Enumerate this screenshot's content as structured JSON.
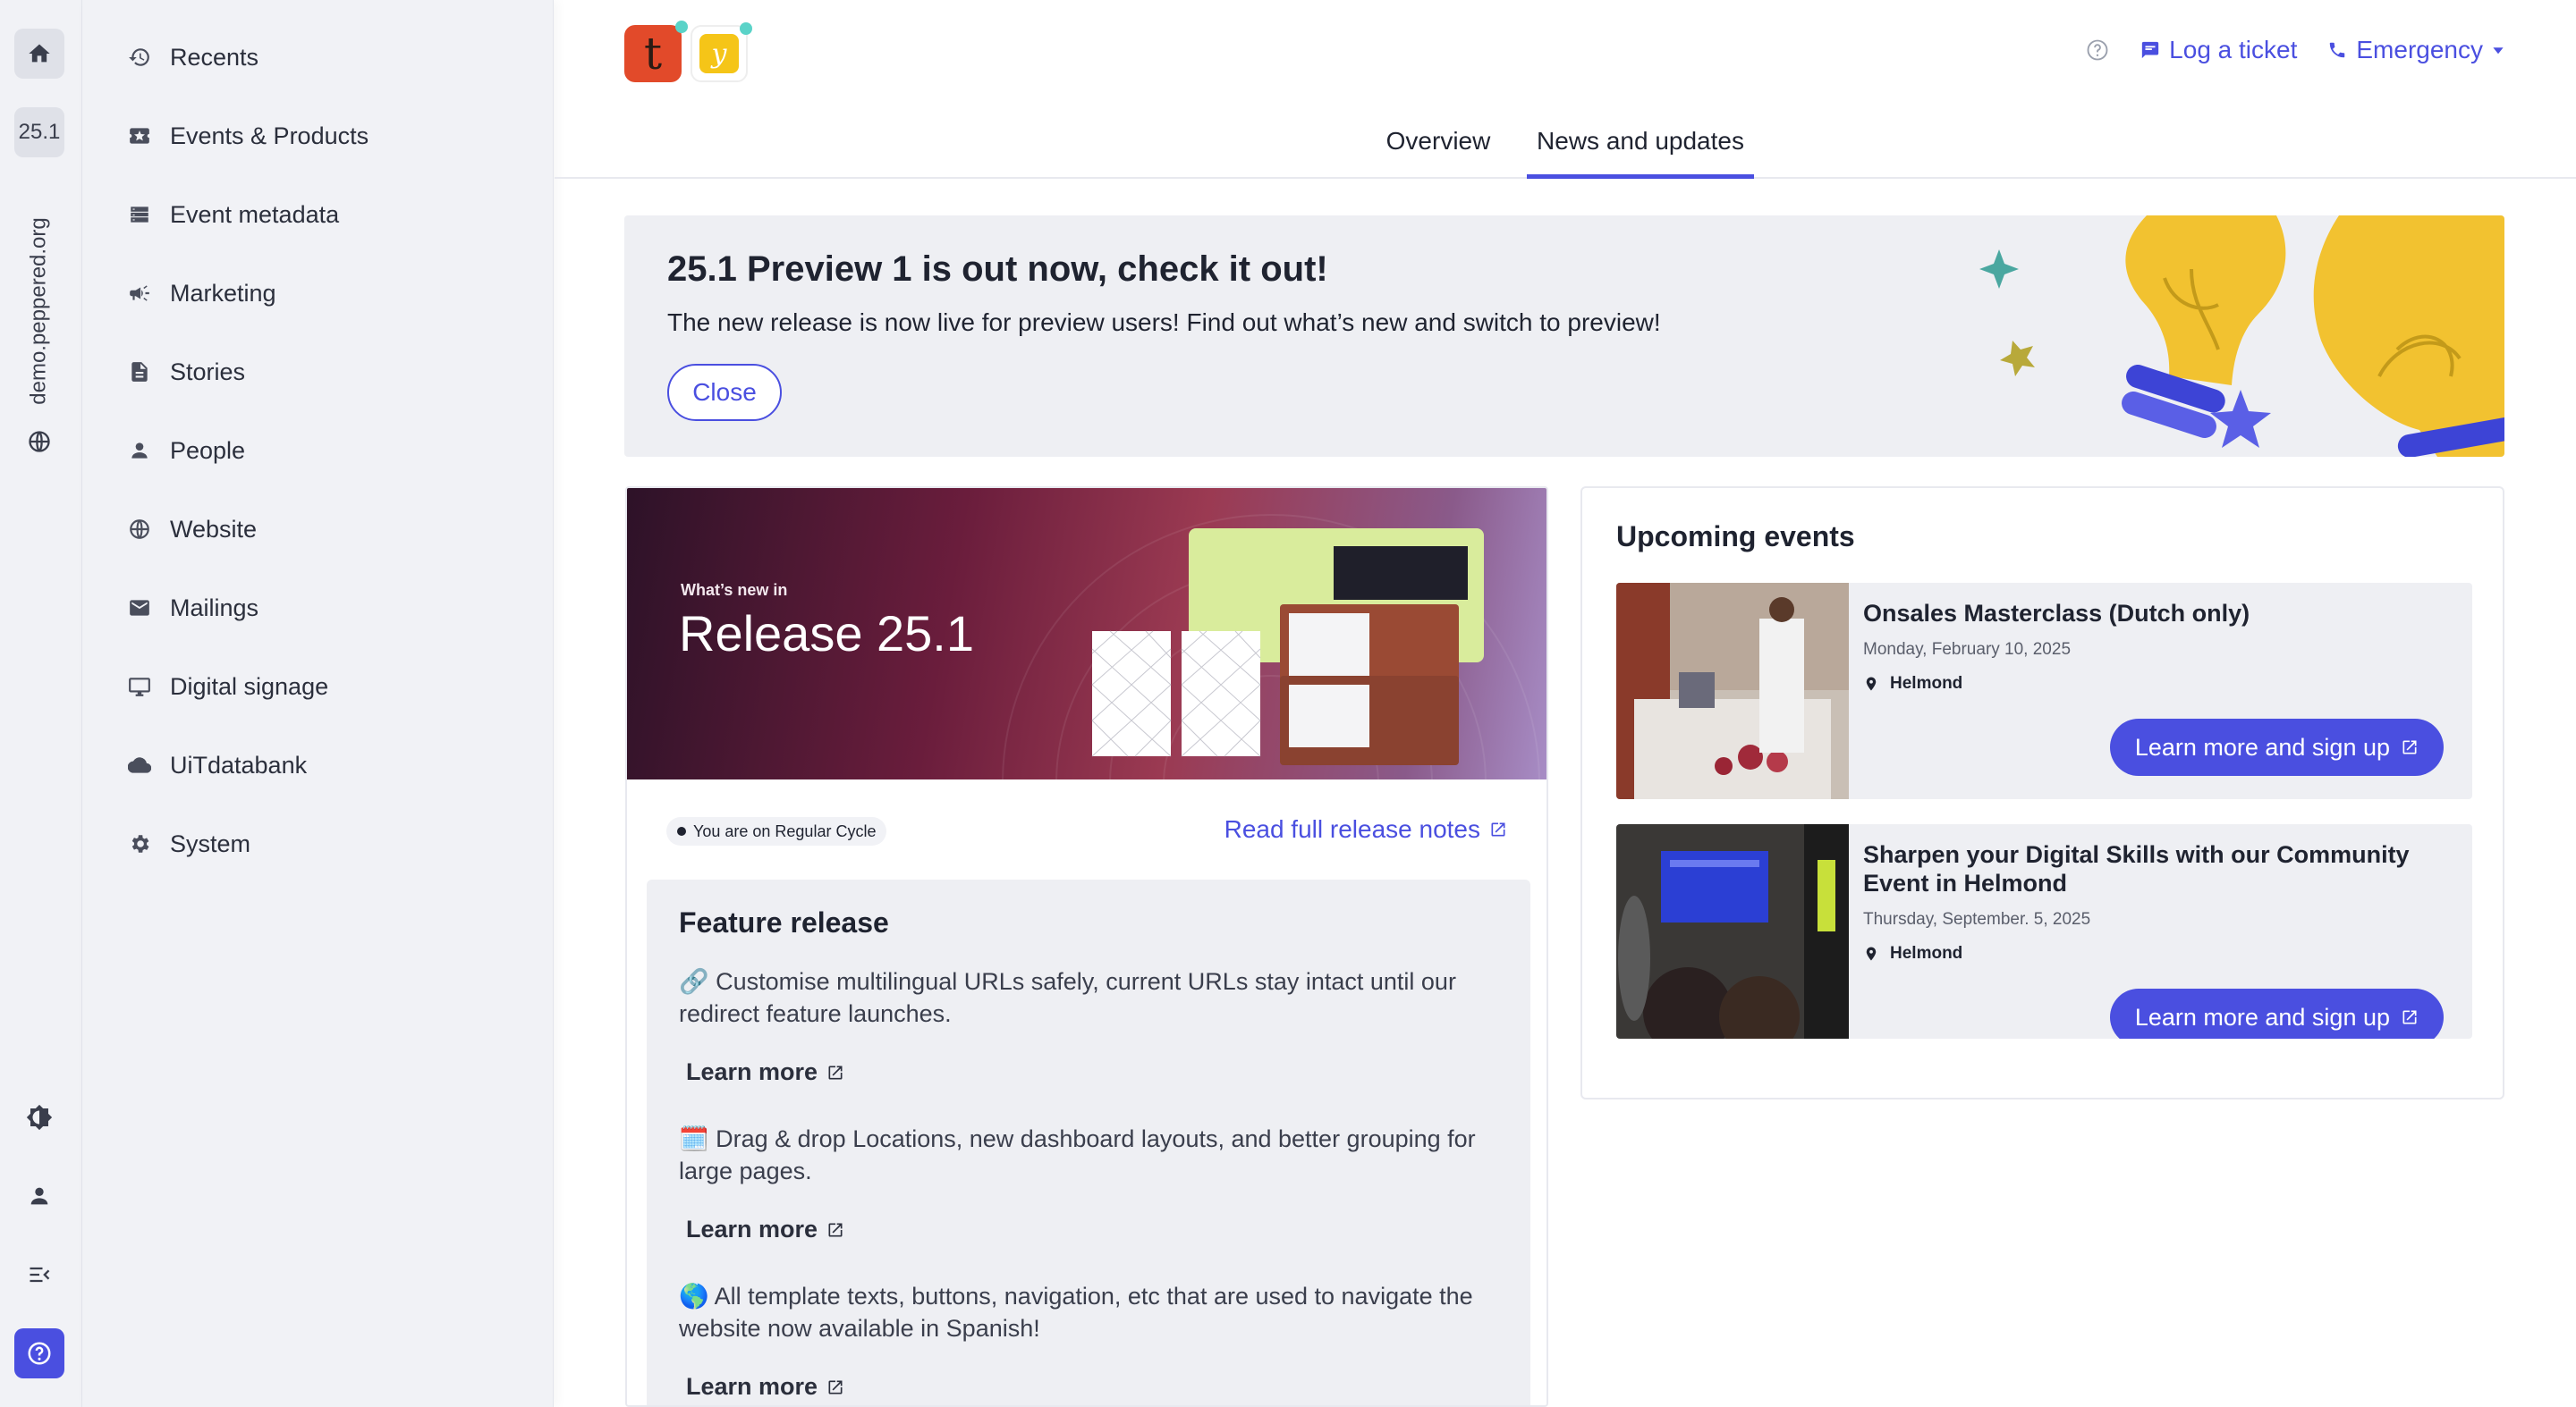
{
  "rail": {
    "version": "25.1",
    "site": "demo.peppered.org"
  },
  "nav": {
    "items": [
      {
        "label": "Recents",
        "icon": "history-icon"
      },
      {
        "label": "Events & Products",
        "icon": "ticket-icon"
      },
      {
        "label": "Event metadata",
        "icon": "list-icon"
      },
      {
        "label": "Marketing",
        "icon": "megaphone-icon"
      },
      {
        "label": "Stories",
        "icon": "document-icon"
      },
      {
        "label": "People",
        "icon": "person-icon"
      },
      {
        "label": "Website",
        "icon": "globe-icon"
      },
      {
        "label": "Mailings",
        "icon": "mail-icon"
      },
      {
        "label": "Digital signage",
        "icon": "monitor-icon"
      },
      {
        "label": "UiTdatabank",
        "icon": "cloud-icon"
      },
      {
        "label": "System",
        "icon": "gear-icon"
      }
    ]
  },
  "header": {
    "logo_t": "t",
    "logo_y": "y",
    "log_ticket": "Log a ticket",
    "emergency": "Emergency"
  },
  "tabs": [
    {
      "label": "Overview",
      "active": false
    },
    {
      "label": "News and updates",
      "active": true
    }
  ],
  "banner": {
    "title": "25.1 Preview 1 is out now, check it out!",
    "text": "The new release is now live for preview users! Find out what’s new and switch to preview!",
    "close": "Close"
  },
  "release": {
    "eyebrow": "What’s new in",
    "title": "Release 25.1",
    "cycle": "You are on Regular Cycle",
    "notes_link": "Read full release notes",
    "feature_heading": "Feature release",
    "features": [
      {
        "text": "🔗 Customise multilingual URLs safely, current URLs stay intact until our redirect feature launches.",
        "link": "Learn more"
      },
      {
        "text": "🗓️ Drag & drop Locations, new dashboard layouts, and better grouping for large pages.",
        "link": "Learn more"
      },
      {
        "text": "🌎 All template texts, buttons, navigation, etc that are used to navigate the website now available in Spanish!",
        "link": "Learn more"
      }
    ]
  },
  "events": {
    "heading": "Upcoming events",
    "items": [
      {
        "title": "Onsales Masterclass (Dutch only)",
        "date": "Monday, February 10, 2025",
        "location": "Helmond",
        "cta": "Learn more and sign up"
      },
      {
        "title": "Sharpen your Digital Skills with our Community Event in Helmond",
        "date": "Thursday, September. 5, 2025",
        "location": "Helmond",
        "cta": "Learn more and sign up"
      }
    ]
  },
  "colors": {
    "accent": "#4a4fe0",
    "sidebar_bg": "#f1f2f6",
    "panel_bg": "#eeeff3"
  }
}
